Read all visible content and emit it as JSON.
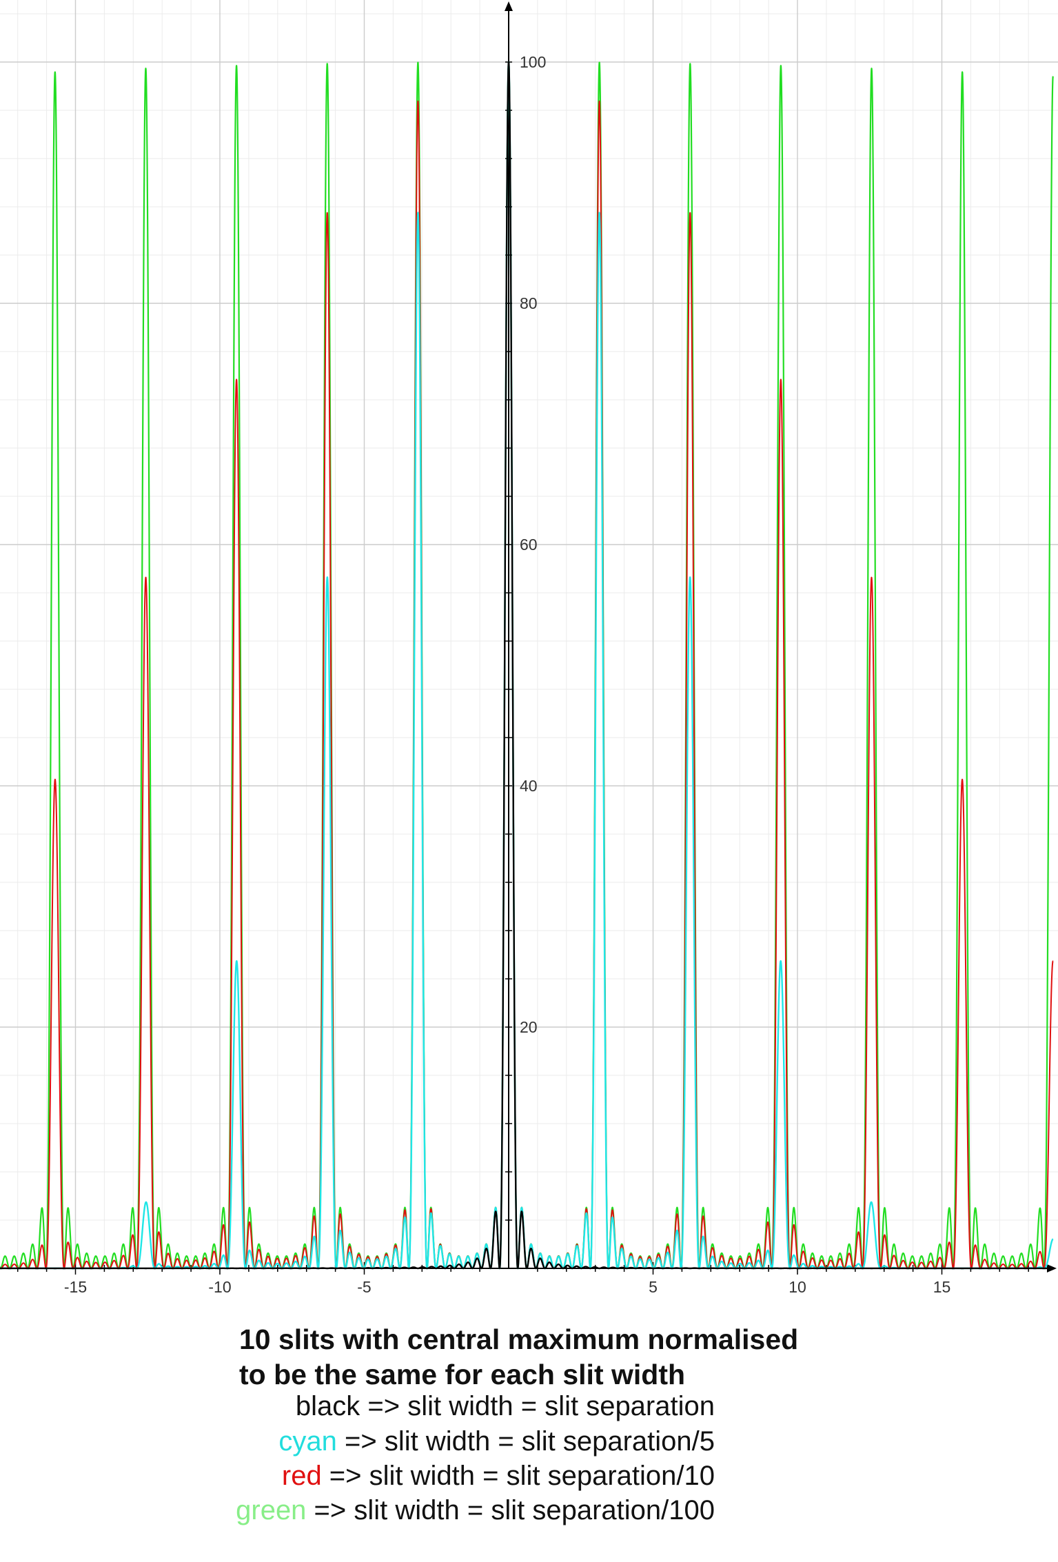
{
  "chart_data": {
    "type": "line",
    "x_axis": {
      "ticks": [
        -15,
        -10,
        -5,
        5,
        10,
        15
      ],
      "range": [
        -17.7,
        19
      ]
    },
    "y_axis": {
      "ticks": [
        20,
        40,
        60,
        80,
        100
      ],
      "range": [
        0,
        105
      ]
    },
    "grid": true,
    "model": {
      "slits": 10,
      "normalized_central_max": 100,
      "principal_max_spacing": 3.1416
    },
    "series": [
      {
        "color_name": "black",
        "color": "#000000",
        "slit_width_ratio": 1,
        "linewidth": 2.4
      },
      {
        "color_name": "cyan",
        "color": "#1fe6e6",
        "slit_width_ratio": 0.2,
        "linewidth": 2.4
      },
      {
        "color_name": "red",
        "color": "#e01010",
        "slit_width_ratio": 0.1,
        "linewidth": 2.0
      },
      {
        "color_name": "green",
        "color": "#22dd22",
        "slit_width_ratio": 0.01,
        "linewidth": 2.2
      }
    ]
  },
  "caption": {
    "title_line1": "10 slits with central maximum normalised",
    "title_line2": "to be the same for each slit width",
    "lines": [
      {
        "word": "black",
        "word_color": "#111111",
        "rest": " => slit width = slit separation"
      },
      {
        "word": "cyan",
        "word_color": "#22dddd",
        "rest": " => slit width = slit separation/5"
      },
      {
        "word": "red",
        "word_color": "#e01010",
        "rest": " => slit width = slit separation/10"
      },
      {
        "word": "green",
        "word_color": "#88ee88",
        "rest": " => slit width = slit separation/100"
      }
    ]
  }
}
